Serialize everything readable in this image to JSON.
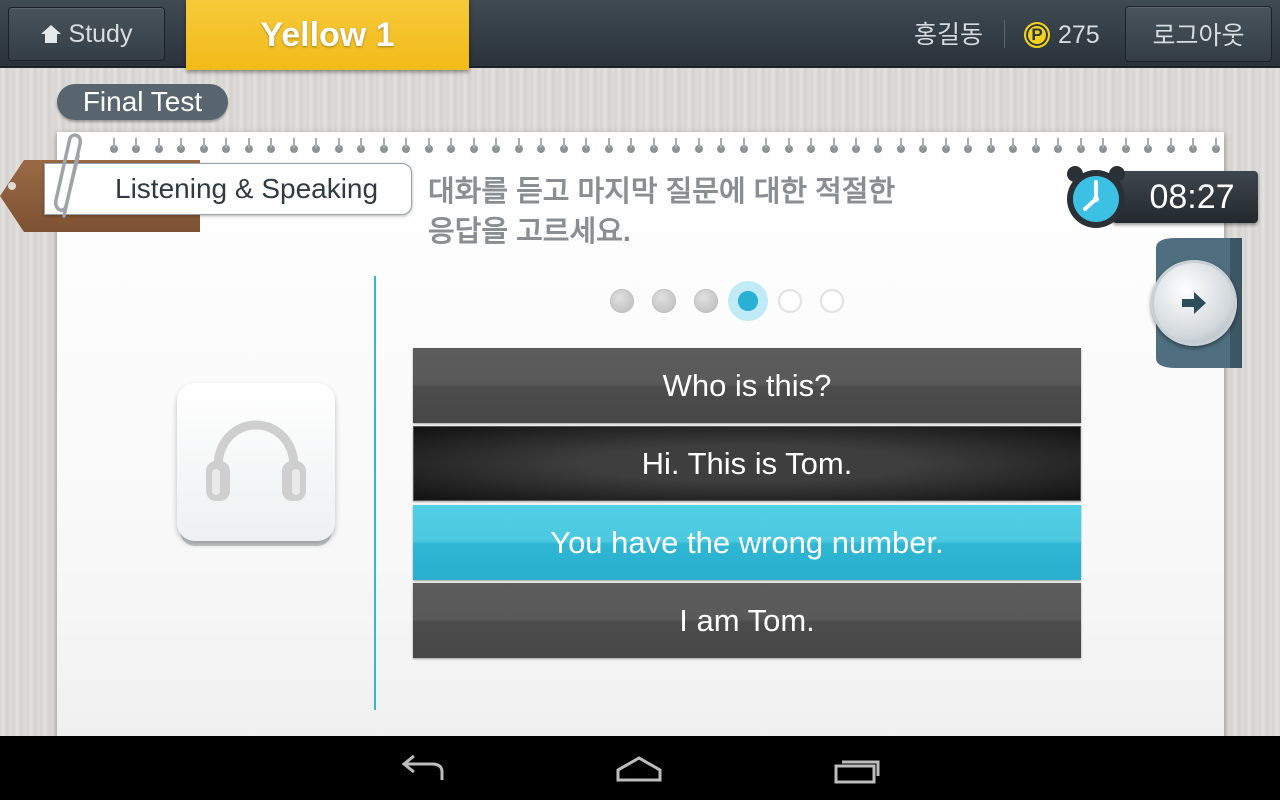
{
  "topbar": {
    "study_label": "Study",
    "level_label": "Yellow 1",
    "user_name": "홍길동",
    "points_symbol": "P",
    "points_value": "275",
    "logout_label": "로그아웃"
  },
  "test": {
    "badge_label": "Final Test",
    "section_label": "Listening & Speaking",
    "instruction_line1": "대화를 듣고 마지막 질문에 대한 적절한",
    "instruction_line2": "응답을 고르세요.",
    "timer": "08:27"
  },
  "progress": {
    "total": 6,
    "current": 4,
    "states": [
      "done",
      "done",
      "done",
      "current",
      "todo",
      "todo"
    ]
  },
  "options": [
    {
      "text": "Who is this?",
      "style": "dark"
    },
    {
      "text": "Hi. This is Tom.",
      "style": "selected-black"
    },
    {
      "text": "You have the wrong number.",
      "style": "blue"
    },
    {
      "text": "I am Tom.",
      "style": "dark"
    }
  ],
  "icons": {
    "home": "home-icon",
    "points": "points-icon",
    "clip": "paperclip-icon",
    "alarm": "alarm-clock-icon",
    "next": "arrow-right-icon",
    "audio": "headphones-icon",
    "nav_back": "back-icon",
    "nav_home": "home-nav-icon",
    "nav_recent": "recent-apps-icon"
  },
  "colors": {
    "accent_yellow": "#F2BE1F",
    "accent_blue": "#36B6D3",
    "topbar_bg": "#343E46",
    "option_dark": "#545454"
  }
}
